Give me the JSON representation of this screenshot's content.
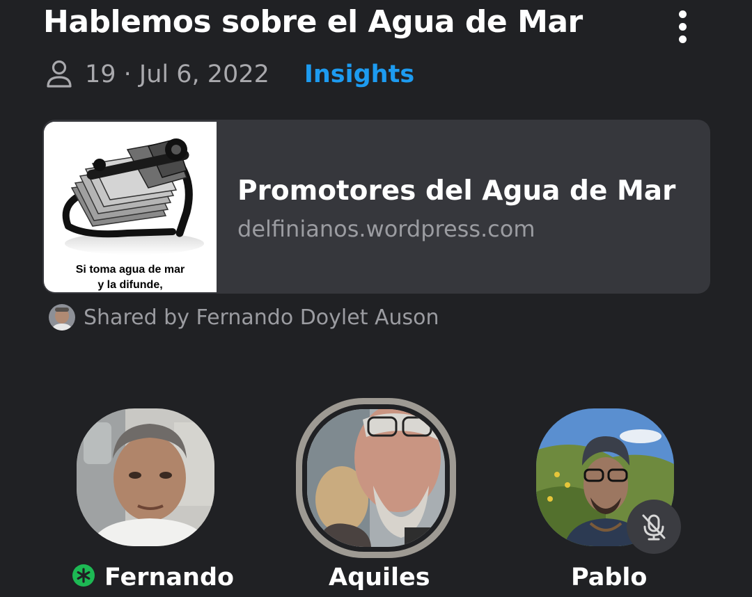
{
  "space": {
    "title": "Hablemos sobre el Agua de Mar",
    "meta": "19 · Jul 6, 2022",
    "insights_label": "Insights"
  },
  "link_card": {
    "title": "Promotores del Agua de Mar",
    "url": "delfinianos.wordpress.com",
    "thumbnail_caption_line1": "Si toma agua de mar",
    "thumbnail_caption_line2": "y la difunde,"
  },
  "shared_by": "Shared by Fernando Doylet Auson",
  "speakers": [
    {
      "name": "Fernando",
      "role": "host",
      "badge_color": "#1db954"
    },
    {
      "name": "Aquiles",
      "speaking": true
    },
    {
      "name": "Pablo",
      "muted": true
    }
  ],
  "colors": {
    "background": "#202124",
    "accent": "#1d9bf0",
    "card": "#36373c",
    "host_badge": "#1db954"
  }
}
